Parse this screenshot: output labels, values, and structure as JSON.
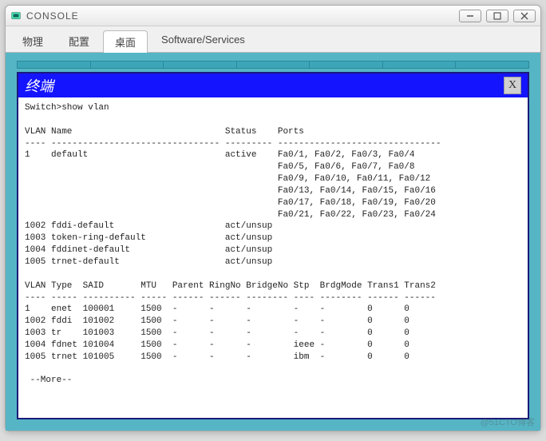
{
  "window": {
    "title": "CONSOLE"
  },
  "tabs": {
    "t0": "物理",
    "t1": "配置",
    "t2": "桌面",
    "t3": "Software/Services"
  },
  "terminal": {
    "title": "终端",
    "close": "X"
  },
  "cli": {
    "prompt": "Switch>show vlan",
    "header1": "VLAN Name                             Status    Ports",
    "divider1": "---- -------------------------------- --------- -------------------------------",
    "row_default": "1    default                          active    Fa0/1, Fa0/2, Fa0/3, Fa0/4",
    "row_default2": "                                                Fa0/5, Fa0/6, Fa0/7, Fa0/8",
    "row_default3": "                                                Fa0/9, Fa0/10, Fa0/11, Fa0/12",
    "row_default4": "                                                Fa0/13, Fa0/14, Fa0/15, Fa0/16",
    "row_default5": "                                                Fa0/17, Fa0/18, Fa0/19, Fa0/20",
    "row_default6": "                                                Fa0/21, Fa0/22, Fa0/23, Fa0/24",
    "row_1002": "1002 fddi-default                     act/unsup",
    "row_1003": "1003 token-ring-default               act/unsup",
    "row_1004": "1004 fddinet-default                  act/unsup",
    "row_1005": "1005 trnet-default                    act/unsup",
    "header2": "VLAN Type  SAID       MTU   Parent RingNo BridgeNo Stp  BrdgMode Trans1 Trans2",
    "divider2": "---- ----- ---------- ----- ------ ------ -------- ---- -------- ------ ------",
    "t_row1": "1    enet  100001     1500  -      -      -        -    -        0      0",
    "t_row2": "1002 fddi  101002     1500  -      -      -        -    -        0      0",
    "t_row3": "1003 tr    101003     1500  -      -      -        -    -        0      0",
    "t_row4": "1004 fdnet 101004     1500  -      -      -        ieee -        0      0",
    "t_row5": "1005 trnet 101005     1500  -      -      -        ibm  -        0      0",
    "more": " --More--"
  },
  "watermark": "@51CTO博客"
}
